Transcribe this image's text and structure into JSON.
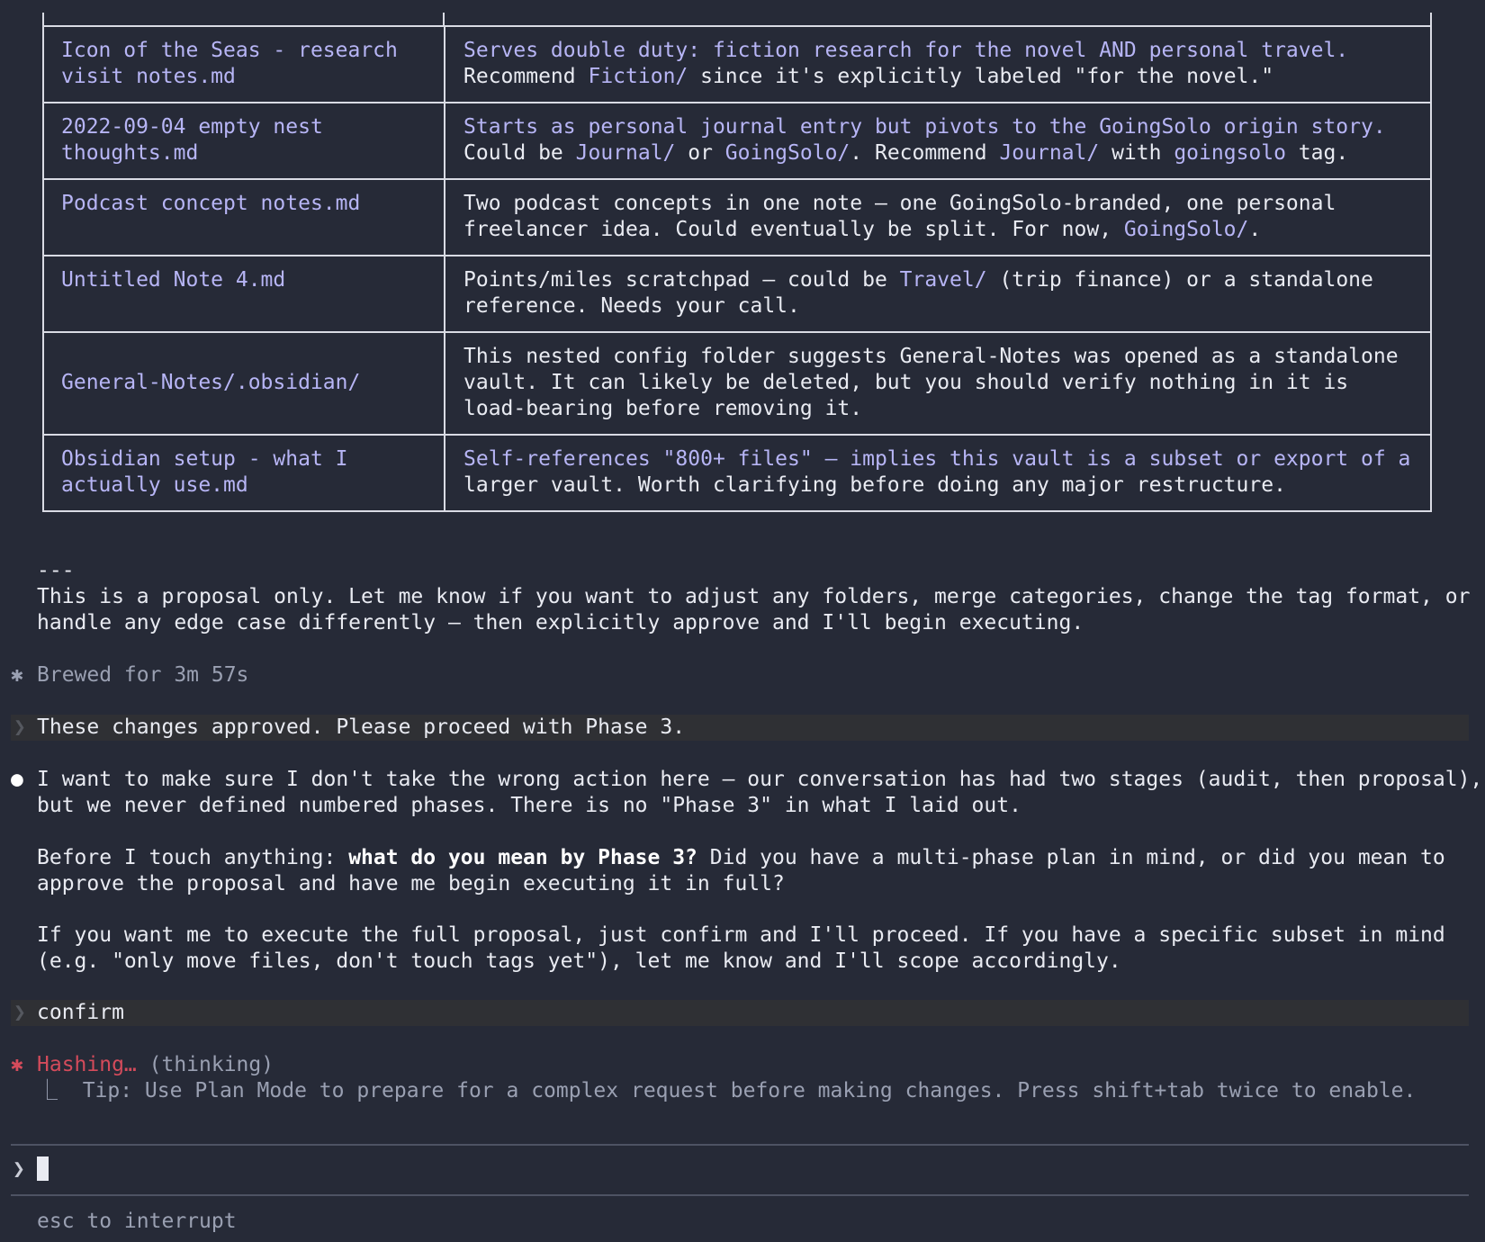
{
  "table": {
    "rows": [
      {
        "file": "Icon of the Seas - research\nvisit notes.md",
        "note_pre": "",
        "note_accent": "Serves double duty: fiction research for the novel AND personal travel.",
        "note_rest_a": "\nRecommend ",
        "note_link_a": "Fiction/",
        "note_rest_b": " since it's explicitly labeled \"for the novel.\""
      },
      {
        "file": "2022-09-04 empty nest\nthoughts.md",
        "note_accent": "Starts as personal journal entry but pivots to the GoingSolo origin story.",
        "note_rest_a": "\nCould be ",
        "note_link_a": "Journal/",
        "note_rest_b": " or ",
        "note_link_b": "GoingSolo/",
        "note_rest_c": ". Recommend ",
        "note_link_c": "Journal/",
        "note_rest_d": " with ",
        "note_link_d": "goingsolo",
        "note_rest_e": " tag."
      },
      {
        "file": "Podcast concept notes.md",
        "note_text": "Two podcast concepts in one note — one GoingSolo-branded, one personal\nfreelancer idea. Could eventually be split. For now, ",
        "note_link": "GoingSolo/",
        "note_end": "."
      },
      {
        "file": "Untitled Note 4.md",
        "note_text": "Points/miles scratchpad — could be ",
        "note_link": "Travel/",
        "note_end": " (trip finance) or a standalone\nreference. Needs your call."
      },
      {
        "file": "General-Notes/.obsidian/",
        "note_text": "This nested config folder suggests General-Notes was opened as a standalone\nvault. It can likely be deleted, but you should verify nothing in it is\nload-bearing before removing it."
      },
      {
        "file": "Obsidian setup - what I\nactually use.md",
        "note_accent": "Self-references \"800+ files\" — implies this vault is a subset or export of a",
        "note_text": "\nlarger vault. Worth clarifying before doing any major restructure."
      }
    ]
  },
  "separator": "---",
  "proposal_text": "This is a proposal only. Let me know if you want to adjust any folders, merge categories, change the tag format, or\nhandle any edge case differently — then explicitly approve and I'll begin executing.",
  "brewed": "Brewed for 3m 57s",
  "user_msg_1": "These changes approved. Please proceed with Phase 3.",
  "reply": {
    "p1": "I want to make sure I don't take the wrong action here — our conversation has had two stages (audit, then proposal),\nbut we never defined numbered phases. There is no \"Phase 3\" in what I laid out.",
    "p2_a": "Before I touch anything: ",
    "p2_b": "what do you mean by Phase 3?",
    "p2_c": " Did you have a multi-phase plan in mind, or did you mean to\napprove the proposal and have me begin executing it in full?",
    "p3": "If you want me to execute the full proposal, just confirm and I'll proceed. If you have a specific subset in mind\n(e.g. \"only move files, don't touch tags yet\"), let me know and I'll scope accordingly."
  },
  "user_msg_2": "confirm",
  "status": {
    "verb": "Hashing…",
    "state": " (thinking)",
    "tip": "⎿  Tip: Use Plan Mode to prepare for a complex request before making changes. Press shift+tab twice to enable."
  },
  "input": {
    "prompt_symbol": "❯",
    "value": ""
  },
  "footer": "esc to interrupt",
  "colors": {
    "background": "#262a37",
    "accent": "#b7b5f5",
    "spinner": "#d44b5b"
  }
}
